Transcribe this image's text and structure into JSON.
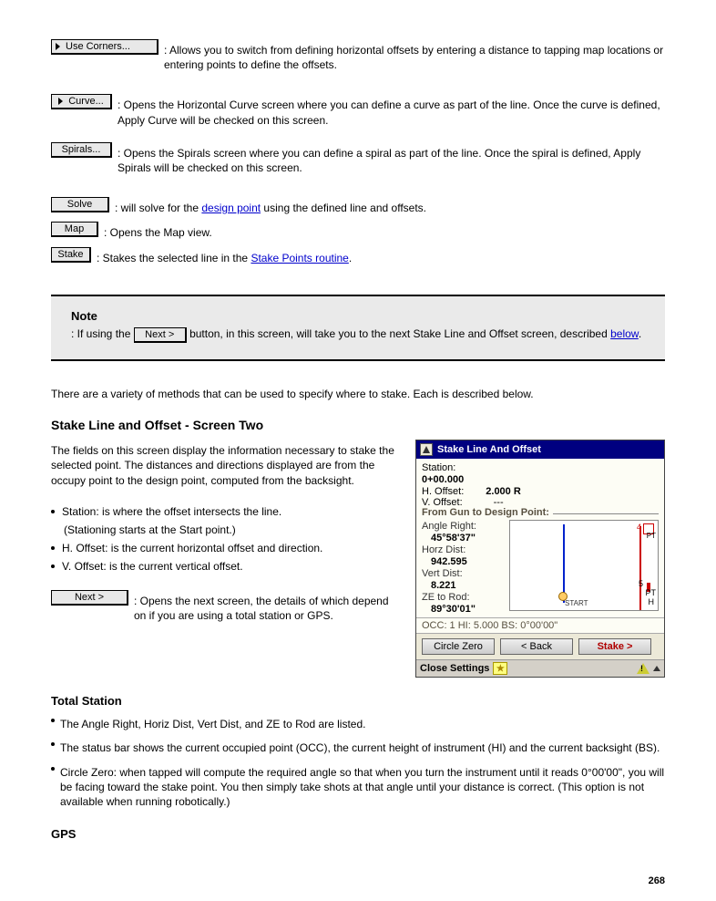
{
  "buttons": {
    "use_corners": "Use Corners...",
    "curve": "Curve...",
    "spirals": "Spirals...",
    "solve": "Solve",
    "map": "Map",
    "stake": "Stake",
    "next": "Next >"
  },
  "text": {
    "use_corners_desc": ": Allows you to switch from defining horizontal offsets by entering a distance to tapping map locations or entering points to define the offsets.",
    "curve_desc": ": Opens the Horizontal Curve screen where you can define a curve as part of the line. Once the curve is defined, Apply Curve will be checked on this screen.",
    "spirals_desc": ": Opens the Spirals screen where you can define a spiral as part of the line. Once the spiral is defined, Apply Spirals will be checked on this screen.",
    "solve_desc": ": will solve for the ",
    "link_design_pt": "design point",
    "solve_desc2": " using the defined line and offsets.",
    "map_desc": ": Opens the Map view.",
    "stake_desc": ": Stakes the selected line in the ",
    "link_stake_pts": "Stake Points routine",
    "stake_desc2": ".",
    "note_title": "Note",
    "note_body1": ": If using the ",
    "note_body2": " button, in this screen, will take you to the next Stake Line and Offset screen, described ",
    "link_below": "below",
    "note_body3": ".",
    "methods_intro": "There are a variety of methods that can be used to specify where to stake. Each is described below.",
    "h1": "Stake Line and Offset - Screen Two",
    "screen_body1": "The fields on this screen display the information necessary to stake the selected point. The distances and directions displayed are from the occupy point to the design point, computed from the backsight.",
    "station_line": "Station: is where the offset intersects the line.",
    "station_sub": "(Stationing starts at the Start point.)",
    "hoffset": "H. Offset: is the current horizontal offset and direction.",
    "voffset": "V. Offset: is the current vertical offset.",
    "next_desc": ": Opens the next screen, the details of which depend on if you are using a total station or GPS.",
    "ts_title": "Total Station",
    "ts_line1": "The Angle Right, Horiz Dist, Vert Dist, and ZE to Rod are listed.",
    "ts_line2": "The status bar shows the current occupied point (OCC), the current height of instrument (HI) and the current backsight (BS).",
    "ts_line3": "Circle Zero: when tapped will compute the required angle so that when you turn the instrument until it reads 0°00'00\", you will be facing toward the stake point. You then simply take shots at that angle until your distance is correct. (This option is not available when running robotically.)",
    "gps_title": "GPS"
  },
  "shot": {
    "title": "Stake Line And Offset",
    "station_lbl": "Station:",
    "station_val": "0+00.000",
    "hoff_lbl": "H. Offset:",
    "hoff_val": "2.000 R",
    "voff_lbl": "V. Offset:",
    "voff_val": "---",
    "legend": "From Gun to Design Point:",
    "angle_lbl": "Angle Right:",
    "angle_val": "45°58'37\"",
    "hd_lbl": "Horz Dist:",
    "hd_val": "942.595",
    "vd_lbl": "Vert Dist:",
    "vd_val": "8.221",
    "ze_lbl": "ZE to Rod:",
    "ze_val": "89°30'01\"",
    "status": "OCC: 1  HI: 5.000  BS: 0°00'00\"",
    "btn_circle": "Circle Zero",
    "btn_back": "< Back",
    "btn_stake": "Stake >",
    "footer": "Close Settings",
    "map_start": "START",
    "map_pt4": "4",
    "map_pt_lbl": "PT",
    "map_pt5": "5",
    "map_h": "H"
  },
  "page_num": "268"
}
